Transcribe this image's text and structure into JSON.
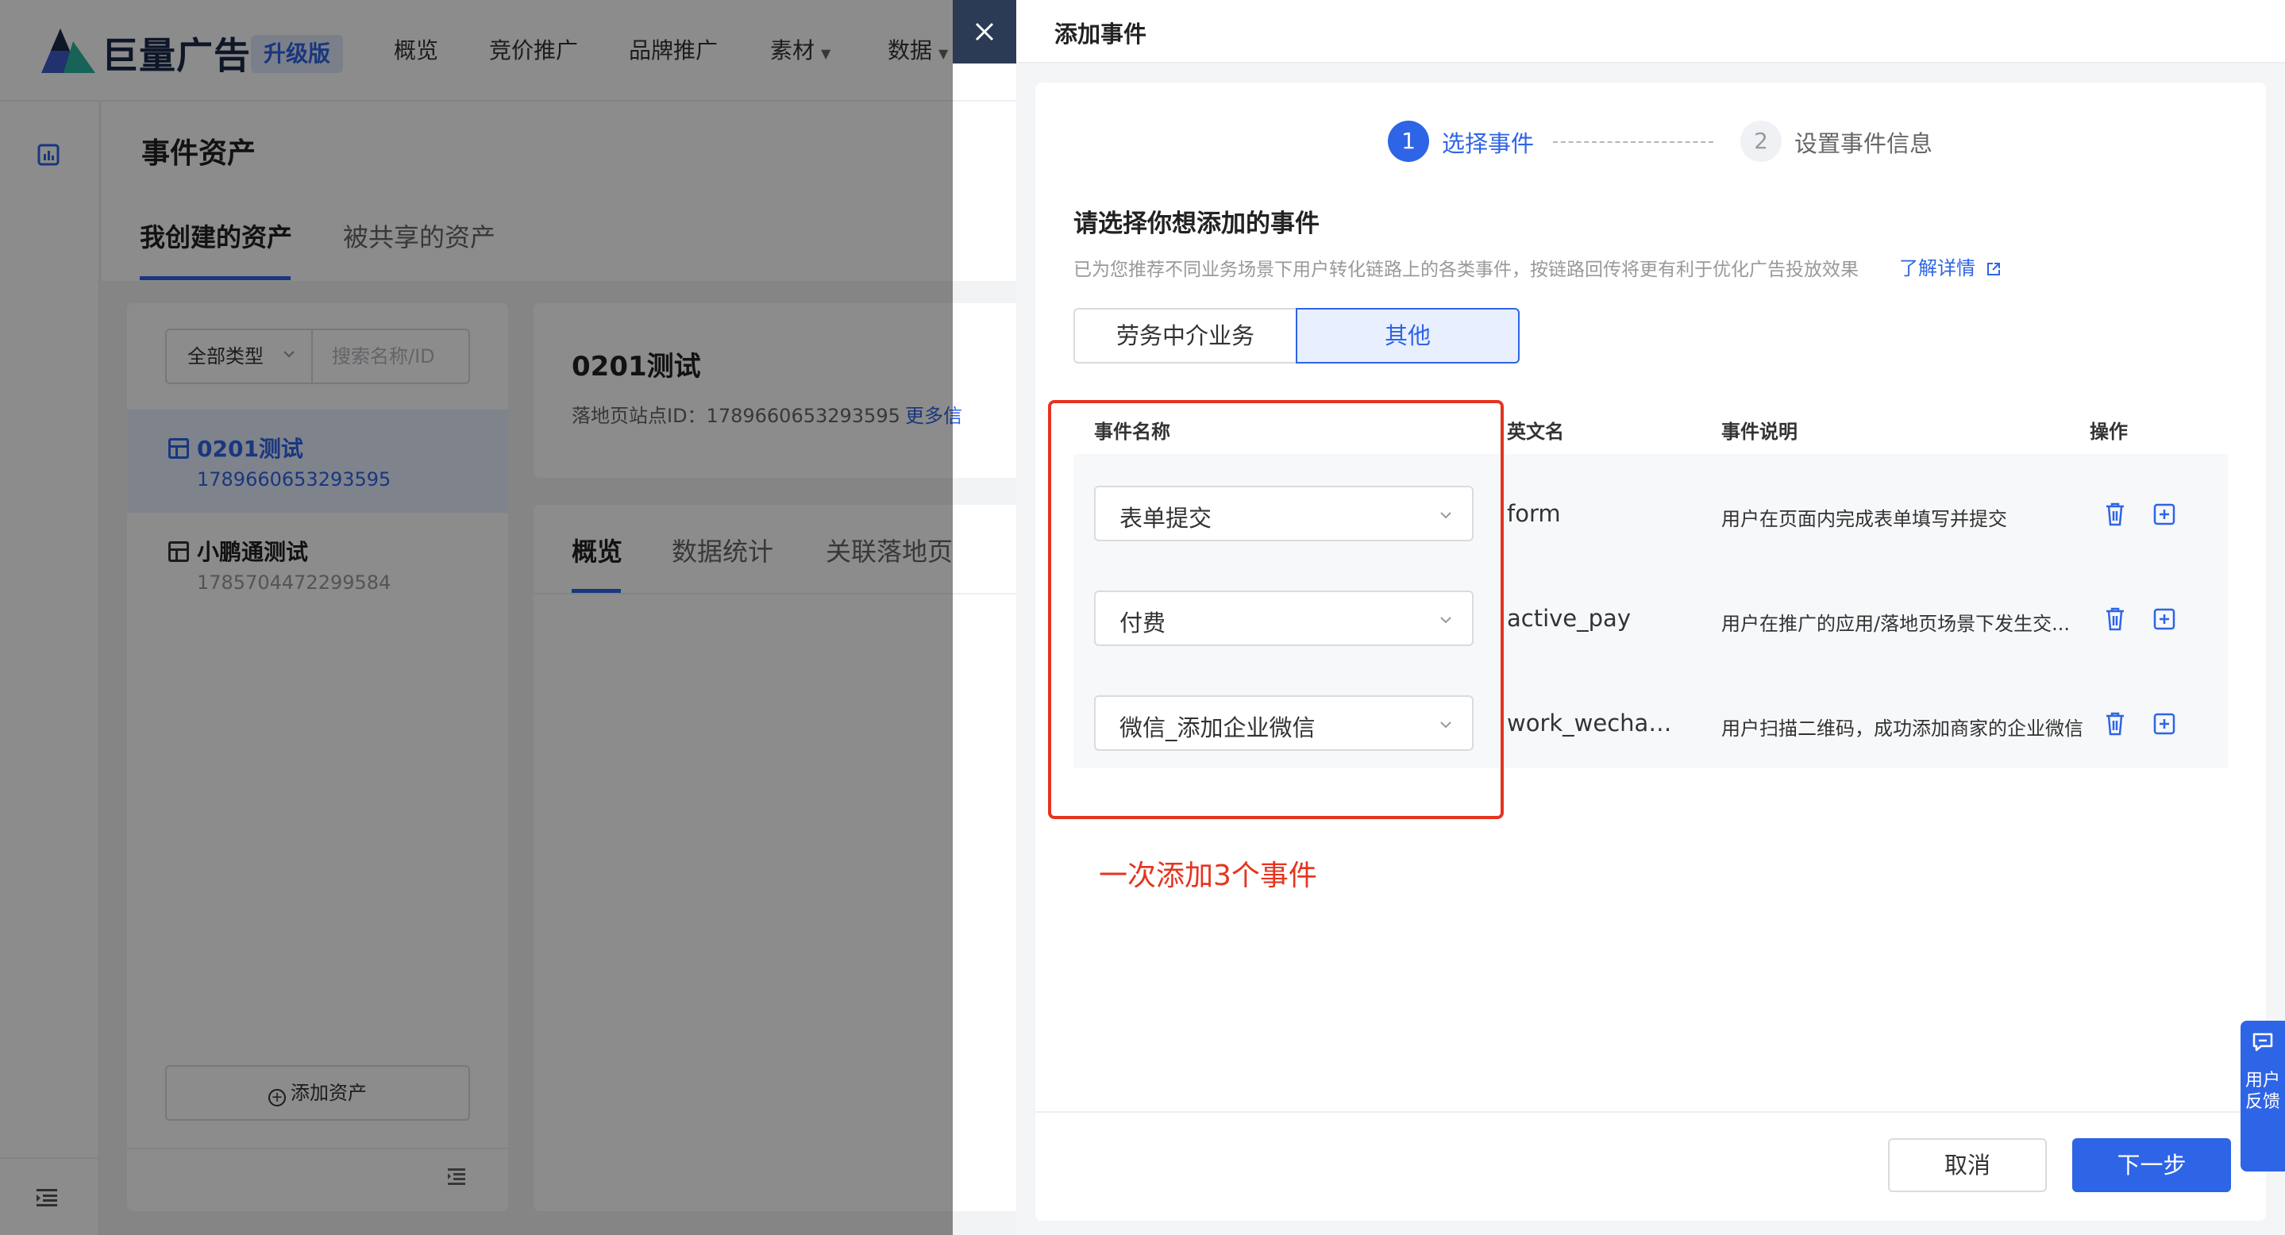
{
  "app": {
    "logo_text": "巨量广告",
    "badge": "升级版",
    "nav": [
      "概览",
      "竞价推广",
      "品牌推广",
      "素材",
      "数据"
    ]
  },
  "page": {
    "title": "事件资产",
    "tabs": [
      "我创建的资产",
      "被共享的资产"
    ]
  },
  "asset_panel": {
    "type_select": "全部类型",
    "search_placeholder": "搜索名称/ID",
    "items": [
      {
        "name": "0201测试",
        "id": "1789660653293595"
      },
      {
        "name": "小鹏通测试",
        "id": "1785704472299584"
      }
    ],
    "add_button": "添加资产"
  },
  "detail": {
    "title": "0201测试",
    "site_id": "落地页站点ID：1789660653293595",
    "more": "更多信",
    "tabs": [
      "概览",
      "数据统计",
      "关联落地页"
    ]
  },
  "drawer": {
    "title": "添加事件",
    "steps": [
      {
        "number": "1",
        "label": "选择事件"
      },
      {
        "number": "2",
        "label": "设置事件信息"
      }
    ],
    "section_title": "请选择你想添加的事件",
    "section_desc": "已为您推荐不同业务场景下用户转化链路上的各类事件，按链路回传将更有利于优化广告投放效果",
    "learn_more": "了解详情",
    "segments": [
      "劳务中介业务",
      "其他"
    ],
    "table": {
      "headers": [
        "事件名称",
        "英文名",
        "事件说明",
        "操作"
      ],
      "rows": [
        {
          "event": "表单提交",
          "en": "form",
          "desc": "用户在页面内完成表单填写并提交"
        },
        {
          "event": "付费",
          "en": "active_pay",
          "desc": "用户在推广的应用/落地页场景下发生交..."
        },
        {
          "event": "微信_添加企业微信",
          "en": "work_wechat_...",
          "desc": "用户扫描二维码，成功添加商家的企业微信"
        }
      ]
    },
    "annotation": "一次添加3个事件",
    "cancel": "取消",
    "next": "下一步"
  },
  "feedback": "用户反馈",
  "colors": {
    "primary": "#2e64e6",
    "annotation_red": "#e5341f",
    "mask": "rgba(0,0,0,0.45)"
  }
}
